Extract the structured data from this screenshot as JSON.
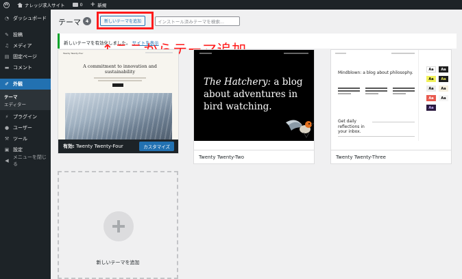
{
  "adminbar": {
    "site_name": "ナレッジ求人サイト",
    "comments_count": "0",
    "new_label": "新規"
  },
  "sidebar": {
    "items": [
      {
        "label": "ダッシュボード",
        "icon": "dashboard-icon"
      },
      {
        "label": "投稿",
        "icon": "pin-icon"
      },
      {
        "label": "メディア",
        "icon": "media-icon"
      },
      {
        "label": "固定ページ",
        "icon": "page-icon"
      },
      {
        "label": "コメント",
        "icon": "comment-icon"
      },
      {
        "label": "外観",
        "icon": "appearance-icon",
        "active": true
      },
      {
        "label": "プラグイン",
        "icon": "plugin-icon"
      },
      {
        "label": "ユーザー",
        "icon": "user-icon"
      },
      {
        "label": "ツール",
        "icon": "wrench-icon"
      },
      {
        "label": "設定",
        "icon": "settings-icon"
      },
      {
        "label": "メニューを閉じる",
        "icon": "collapse-icon"
      }
    ],
    "submenu": [
      "テーマ",
      "エディター"
    ]
  },
  "header": {
    "title": "テーマ",
    "count": "4",
    "add_button": "新しいテーマを追加",
    "search_placeholder": "インストール済みテーマを検索..."
  },
  "notice": {
    "text": "新しいテーマを有効化しました。",
    "link": "サイトを表示"
  },
  "annotation": "↑ここからテーマ追加",
  "themes": [
    {
      "name": "Twenty Twenty-Four",
      "active_prefix": "有効:",
      "customize": "カスタマイズ",
      "preview": {
        "headline": "A commitment to innovation and sustainability"
      }
    },
    {
      "name": "Twenty Twenty-Two",
      "preview": {
        "headline_em": "The Hatchery:",
        "headline_rest": "a blog about adventures in bird watching."
      }
    },
    {
      "name": "Twenty Twenty-Three",
      "preview": {
        "headline": "Mindblown: a blog about philosophy.",
        "cta": "Get daily reflections in your inbox."
      }
    }
  ],
  "add_new_label": "新しいテーマを追加",
  "colors": {
    "admin_dark": "#1d2327",
    "accent": "#2271b1",
    "highlight": "#ff1a1a",
    "success": "#00a32a"
  }
}
